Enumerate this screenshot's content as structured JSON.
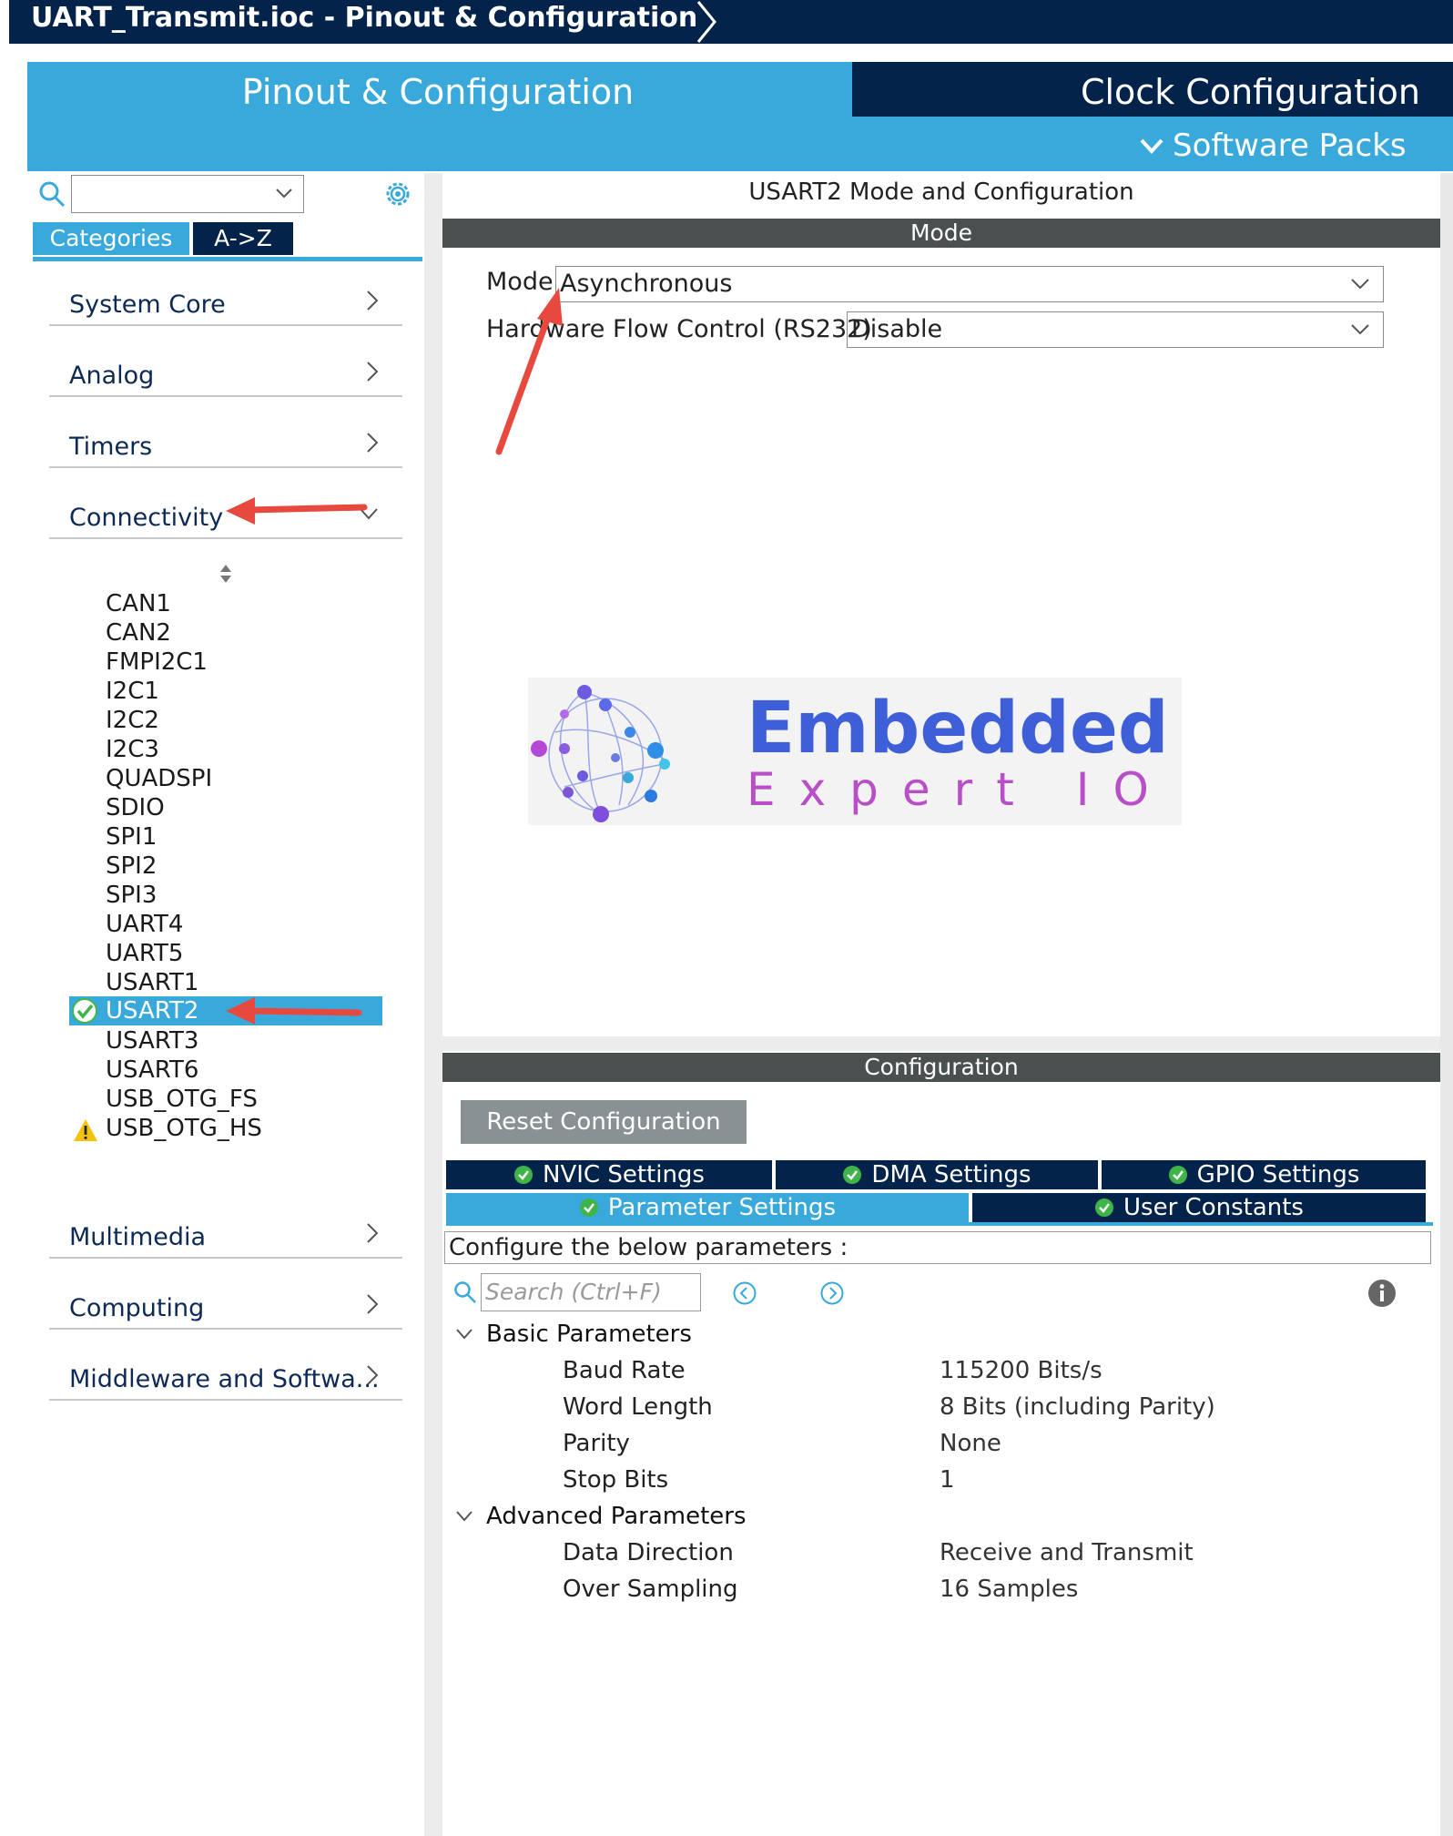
{
  "window": {
    "breadcrumb": "UART_Transmit.ioc - Pinout & Configuration"
  },
  "header": {
    "tab_pinout": "Pinout & Configuration",
    "tab_clock": "Clock Configuration",
    "software_packs": "Software Packs"
  },
  "sidebar": {
    "search_value": "",
    "btn_categories": "Categories",
    "btn_az": "A->Z",
    "categories": [
      "System Core",
      "Analog",
      "Timers",
      "Connectivity"
    ],
    "peripherals": [
      "CAN1",
      "CAN2",
      "FMPI2C1",
      "I2C1",
      "I2C2",
      "I2C3",
      "QUADSPI",
      "SDIO",
      "SPI1",
      "SPI2",
      "SPI3",
      "UART4",
      "UART5",
      "USART1",
      "USART2",
      "USART3",
      "USART6",
      "USB_OTG_FS",
      "USB_OTG_HS"
    ],
    "categories_bottom": [
      "Multimedia",
      "Computing",
      "Middleware and Softwa..."
    ],
    "selected": "USART2"
  },
  "mode": {
    "title": "USART2 Mode and Configuration",
    "section": "Mode",
    "mode_label": "Mode",
    "mode_value": "Asynchronous",
    "hfc_label": "Hardware Flow Control (RS232)",
    "hfc_value": "Disable"
  },
  "logo": {
    "line1": "Embedded",
    "line2": "Expert IO"
  },
  "config": {
    "section": "Configuration",
    "reset": "Reset Configuration",
    "tabs": {
      "nvic": "NVIC Settings",
      "dma": "DMA Settings",
      "gpio": "GPIO Settings",
      "param": "Parameter Settings",
      "user": "User Constants"
    },
    "description": "Configure the below parameters :",
    "search_placeholder": "Search (Ctrl+F)",
    "groups": [
      {
        "name": "Basic Parameters",
        "params": [
          {
            "name": "Baud Rate",
            "value": "115200 Bits/s"
          },
          {
            "name": "Word Length",
            "value": "8 Bits (including Parity)"
          },
          {
            "name": "Parity",
            "value": "None"
          },
          {
            "name": "Stop Bits",
            "value": "1"
          }
        ]
      },
      {
        "name": "Advanced Parameters",
        "params": [
          {
            "name": "Data Direction",
            "value": "Receive and Transmit"
          },
          {
            "name": "Over Sampling",
            "value": "16 Samples"
          }
        ]
      }
    ]
  },
  "colors": {
    "navy": "#03234b",
    "accent_blue": "#39a9dc",
    "section_gray": "#4a4f50",
    "annotation_red": "#e8493e",
    "check_green": "#3fb549",
    "warning_yellow": "#f4c20d"
  }
}
